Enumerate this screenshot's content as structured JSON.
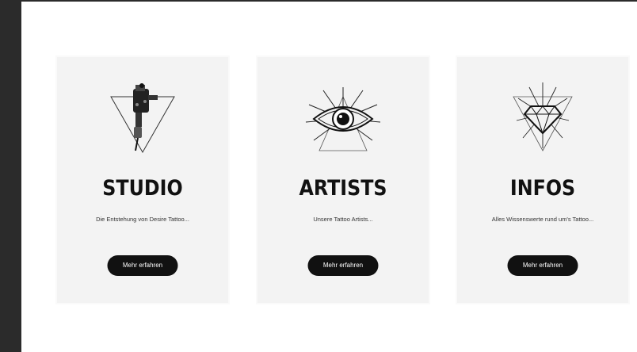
{
  "cards": [
    {
      "title": "STUDIO",
      "description": "Die Entstehung von Desire Tattoo...",
      "button_label": "Mehr erfahren",
      "icon": "tattoo-machine-icon"
    },
    {
      "title": "ARTISTS",
      "description": "Unsere Tattoo Artists...",
      "button_label": "Mehr erfahren",
      "icon": "all-seeing-eye-icon"
    },
    {
      "title": "INFOS",
      "description": "Alles Wissenswerte rund um's Tattoo...",
      "button_label": "Mehr erfahren",
      "icon": "diamond-icon"
    }
  ],
  "colors": {
    "card_background": "#f3f3f3",
    "button_background": "#111111",
    "button_text": "#ffffff",
    "title_text": "#111111",
    "frame": "#2b2b2b"
  }
}
